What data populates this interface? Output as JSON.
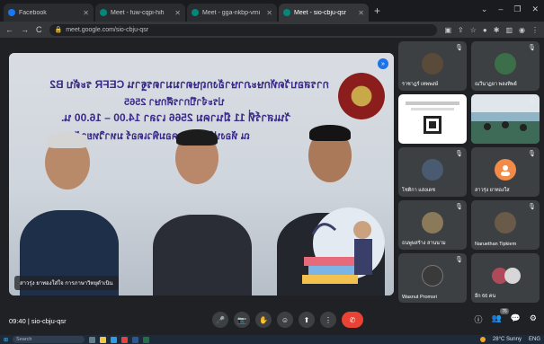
{
  "browser": {
    "tabs": [
      {
        "label": "Facebook",
        "active": false,
        "color": "#1877f2"
      },
      {
        "label": "Meet - fuw-cqpi-hih",
        "active": false,
        "color": "#00897b"
      },
      {
        "label": "Meet - gga-nkbp-vmi",
        "active": false,
        "color": "#00897b"
      },
      {
        "label": "Meet - sio-cbju-qsr",
        "active": true,
        "color": "#00897b"
      }
    ],
    "new_tab_glyph": "+",
    "window_controls": [
      "⌄",
      "–",
      "❐",
      "✕"
    ],
    "url": "meet.google.com/sio-cbju-qsr",
    "nav": {
      "back": "←",
      "forward": "→",
      "reload": "C"
    }
  },
  "presentation": {
    "slide_lines": [
      "การสอบวัดทักษะภาษาอังกฤษตามมาตรฐาน CEFR ระดับ B2",
      "ประจำปีการศึกษา 2565",
      "วันเสาร์ที่ 11 มีนาคม 2566 เวลา 14.00 – 16.00 น.",
      "ณ ห้องปฏิบัติการคอมพิวเตอร์ มหาวิทยาลัย 4"
    ],
    "presenter_caption": "สาวรุ่ง ยาทองใส่ใจ การภาษาวิทยุดำเนิน",
    "pin_glyph": "»"
  },
  "participants": [
    {
      "name": "ราชาฎร์ เทพพงษ์",
      "muted": true,
      "avatar": "photo",
      "color": "#5a4a3a"
    },
    {
      "name": "ณวีนาฏยา พลงทิพย์",
      "muted": true,
      "avatar": "photo",
      "color": "#3c6e4a"
    },
    {
      "name": "",
      "muted": false,
      "avatar": "screen",
      "color": "#ffffff"
    },
    {
      "name": "",
      "muted": false,
      "avatar": "classroom",
      "color": "#8fb4c6"
    },
    {
      "name": "โชติกา แสงเดช",
      "muted": true,
      "avatar": "photo",
      "color": "#4a5a70"
    },
    {
      "name": "สาวรุ่ง ยาทองใส",
      "muted": true,
      "avatar": "initial",
      "color": "#f28b48"
    },
    {
      "name": "ธนพูษสร้าง สานนาม",
      "muted": true,
      "avatar": "photo",
      "color": "#8a7a5a"
    },
    {
      "name": "Naruethan Tipkiem",
      "muted": true,
      "avatar": "photo",
      "color": "#6a5a4a"
    },
    {
      "name": "Wasnut Promsri",
      "muted": true,
      "avatar": "photo",
      "color": "#3a3a3a"
    },
    {
      "name": "อีก 66 คน",
      "muted": false,
      "avatar": "group",
      "color": "#b04a5a"
    }
  ],
  "meeting": {
    "time": "09:40",
    "separator": "|",
    "code": "sio-cbju-qsr",
    "participant_count": "76",
    "controls": [
      "🎤",
      "📷",
      "✋",
      "☺",
      "⬆",
      "⋮",
      "✆"
    ],
    "right_controls": [
      "ⓘ",
      "👥",
      "💬",
      "⚙"
    ]
  },
  "taskbar": {
    "search_placeholder": "Search",
    "tray_text": "28°C Sunny",
    "tray_lang": "ENG"
  },
  "accent": "#1a73e8",
  "end_call_color": "#ea4335"
}
